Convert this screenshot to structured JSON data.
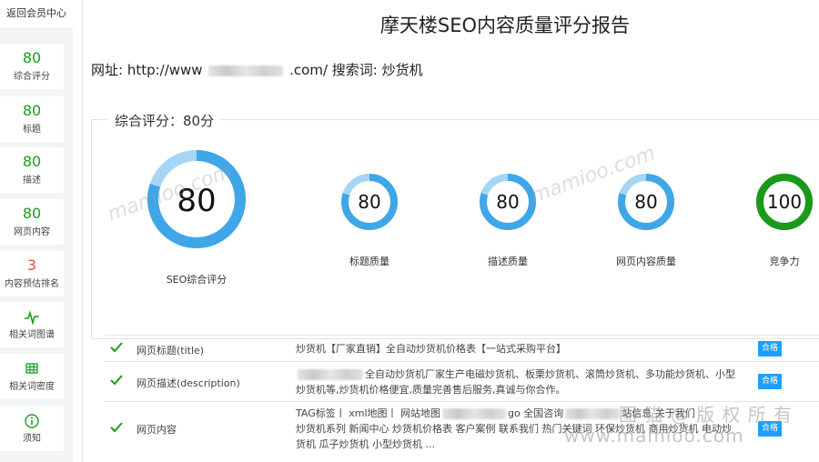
{
  "sidebar": {
    "back_label": "返回会员中心",
    "items": [
      {
        "value": "80",
        "label": "综合评分",
        "color": "#1aa01a"
      },
      {
        "value": "80",
        "label": "标题",
        "color": "#1aa01a"
      },
      {
        "value": "80",
        "label": "描述",
        "color": "#1aa01a"
      },
      {
        "value": "80",
        "label": "网页内容",
        "color": "#1aa01a"
      },
      {
        "value": "3",
        "label": "内容预估排名",
        "color": "#e84a3c"
      },
      {
        "icon": "pulse-icon",
        "label": "相关词图谱"
      },
      {
        "icon": "grid-table-icon",
        "label": "相关词密度"
      },
      {
        "icon": "info-circle-icon",
        "label": "须知"
      }
    ]
  },
  "header": {
    "title": "摩天楼SEO内容质量评分报告",
    "url_prefix": "网址: http://www",
    "url_suffix": ".com/ 搜索词: 炒货机"
  },
  "summary": {
    "legend": "综合评分：80分",
    "gauges": [
      {
        "value": 80,
        "label": "SEO综合评分",
        "color": "#3fa6e8",
        "track": "#a7d5f5"
      },
      {
        "value": 80,
        "label": "标题质量",
        "color": "#3fa6e8",
        "track": "#a7d5f5"
      },
      {
        "value": 80,
        "label": "描述质量",
        "color": "#3fa6e8",
        "track": "#a7d5f5"
      },
      {
        "value": 80,
        "label": "网页内容质量",
        "color": "#3fa6e8",
        "track": "#a7d5f5"
      },
      {
        "value": 100,
        "label": "竞争力",
        "color": "#1a9a1a",
        "track": "#1a9a1a"
      }
    ]
  },
  "rows": [
    {
      "name": "网页标题(title)",
      "value": "炒货机【厂家直销】全自动炒货机价格表【一站式采购平台】",
      "status": "合格"
    },
    {
      "name": "网页描述(description)",
      "value_a": "全自动炒货机厂家生产电磁炒货机、板栗炒货机、滚筒炒货机、多功能炒货机、小型",
      "value_b": "炒货机等,炒货机价格便宜,质量完善售后服务,真诚与你合作。",
      "status": "合格"
    },
    {
      "name": "网页内容",
      "value_a": "TAG标签丨 xml地图丨 网站地图",
      "value_a2": "go 全国咨询",
      "value_a3": "站信息 关于我们",
      "value_b": "炒货机系列 新闻中心 炒货机价格表 客户案例 联系我们 热门关键词 环保炒货机 商用炒货机 电动炒",
      "value_c": "货机 瓜子炒货机 小型炒货机 ...",
      "status": "合格"
    }
  ],
  "watermark": {
    "text": "mamioo.com",
    "text2": "图 猫 @ 版 权 所 有",
    "text3": "www.mamioo.com"
  },
  "colors": {
    "check": "#1aa01a",
    "badge": "#1e9fff"
  }
}
